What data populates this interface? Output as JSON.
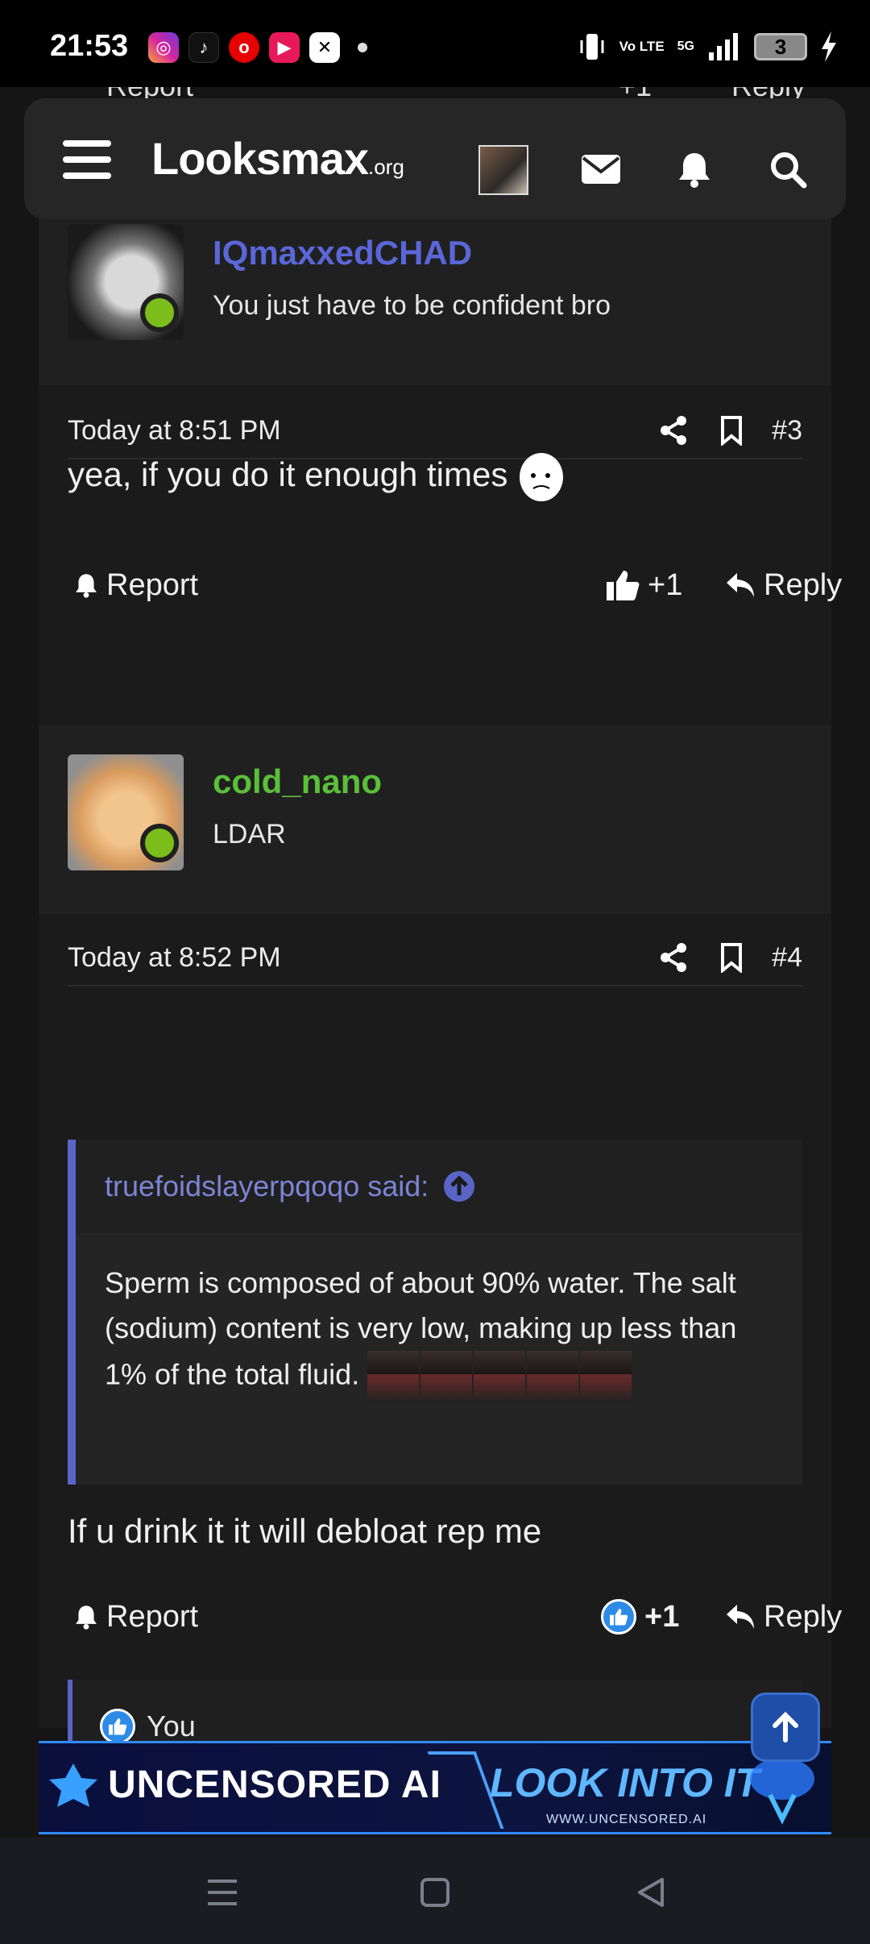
{
  "status_bar": {
    "time": "21:53",
    "network": "5G",
    "volte": "Vo LTE",
    "battery": "3",
    "apps": [
      "instagram-icon",
      "tiktok-icon",
      "vodafone-icon",
      "video-app-icon",
      "capcut-icon"
    ]
  },
  "header": {
    "logo": "Looksmax",
    "logo_suffix": ".org"
  },
  "top_partial": {
    "report": "Report",
    "like": "+1",
    "reply": "Reply"
  },
  "post3": {
    "username": "IQmaxxedCHAD",
    "user_title": "You just have to be confident bro",
    "time": "Today at 8:51 PM",
    "number": "#3",
    "message": "yea, if you do it enough times",
    "report": "Report",
    "like_count": "+1",
    "reply": "Reply"
  },
  "post4": {
    "username": "cold_nano",
    "user_title": "LDAR",
    "time": "Today at 8:52 PM",
    "number": "#4",
    "quote_author": "truefoidslayerpqoqo said:",
    "quote_text": "Sperm is composed of about 90% water. The salt (sodium) content is very low, making up less than 1% of the total fluid.",
    "message": "If u drink it it will debloat rep me",
    "report": "Report",
    "like_count": "+1",
    "reply": "Reply",
    "reactions_user": "You"
  },
  "ad": {
    "left_text": "UNCENSORED AI",
    "right_text": "LOOK INTO IT",
    "url": "WWW.UNCENSORED.AI"
  },
  "colors": {
    "username_blue": "#5a67d8",
    "username_green": "#5bbf3a",
    "online": "#7bbd1a",
    "quote_accent": "#5865c7"
  }
}
